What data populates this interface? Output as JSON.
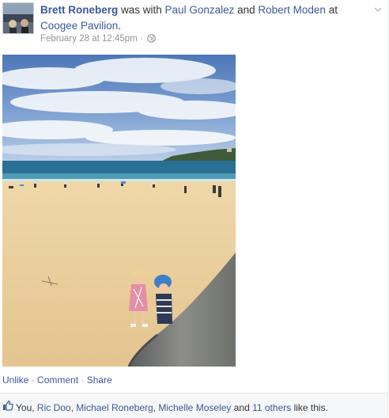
{
  "post": {
    "author": "Brett Roneberg",
    "with_text": " was with ",
    "friend1": "Paul Gonzalez",
    "and_text": " and ",
    "friend2": "Robert Moden",
    "at_text": " at",
    "place": "Coogee Pavilion",
    "period": ".",
    "timestamp": "February 28 at 12:45pm",
    "separator": " · ",
    "privacy_icon": "globe-icon"
  },
  "actions": {
    "unlike": "Unlike",
    "comment": "Comment",
    "share": "Share",
    "dot": " · "
  },
  "likes": {
    "icon": "thumbs-up-icon",
    "you": "You, ",
    "names": [
      "Ric Doo",
      "Michael Roneberg",
      "Michelle Moseley"
    ],
    "comma": ", ",
    "and_text": " and ",
    "others": "11 others",
    "suffix": " like this."
  },
  "colors": {
    "link": "#3b5998",
    "meta": "#90949c",
    "bar_bg": "#f6f7f9"
  }
}
